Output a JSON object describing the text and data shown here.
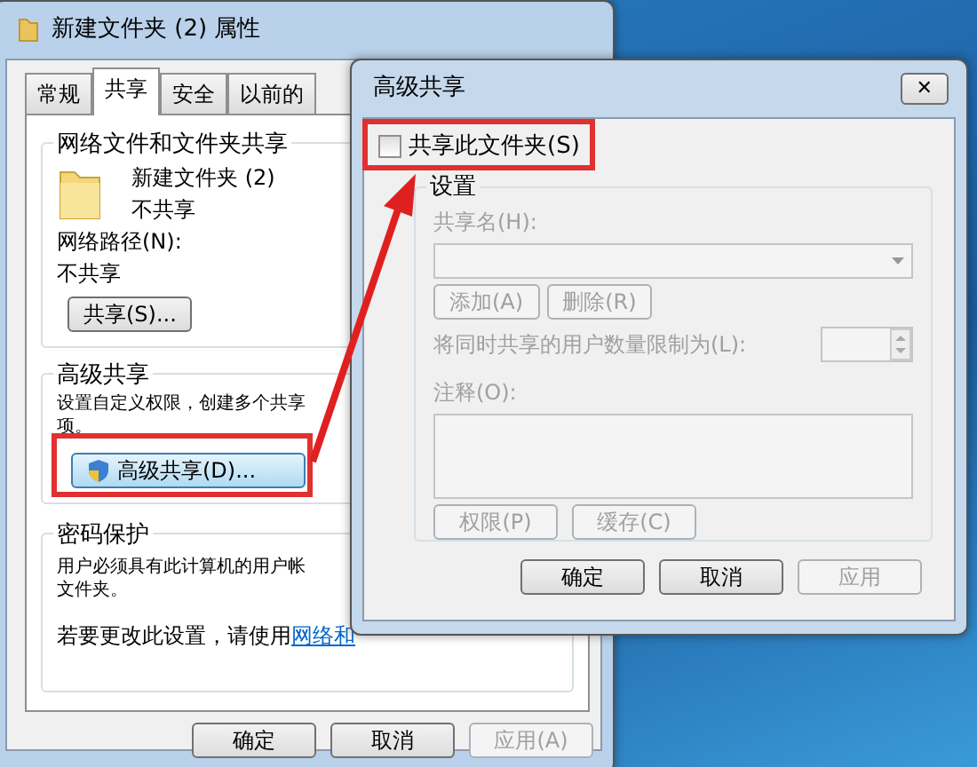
{
  "properties_window": {
    "title": "新建文件夹 (2) 属性",
    "tabs": [
      {
        "label": "常规",
        "selected": false
      },
      {
        "label": "共享",
        "selected": true
      },
      {
        "label": "安全",
        "selected": false
      },
      {
        "label": "以前的",
        "selected": false
      }
    ],
    "network_sharing": {
      "heading": "网络文件和文件夹共享",
      "folder_name": "新建文件夹 (2)",
      "folder_status": "不共享",
      "path_label": "网络路径(N):",
      "path_value": "不共享",
      "share_button": "共享(S)..."
    },
    "advanced_sharing": {
      "heading": "高级共享",
      "description": [
        "设置自定义权限，创建多个共享",
        "项。"
      ],
      "button": "高级共享(D)..."
    },
    "password_protection": {
      "heading": "密码保护",
      "description": [
        "用户必须具有此计算机的用户帐",
        "文件夹。"
      ],
      "change_text": "若要更改此设置，请使用",
      "link": "网络和"
    },
    "buttons": [
      {
        "label": "确定",
        "disabled": false
      },
      {
        "label": "取消",
        "disabled": false
      },
      {
        "label": "应用(A)",
        "disabled": true
      }
    ]
  },
  "advanced_dialog": {
    "title": "高级共享",
    "close": "✕",
    "share_checkbox": {
      "label": "共享此文件夹(S)",
      "checked": false
    },
    "settings": {
      "heading": "设置",
      "disabled": true,
      "share_name_label": "共享名(H):",
      "add_button": "添加(A)",
      "remove_button": "删除(R)",
      "limit_label": "将同时共享的用户数量限制为(L):",
      "comment_label": "注释(O):",
      "permissions_button": "权限(P)",
      "cache_button": "缓存(C)"
    },
    "buttons": [
      {
        "label": "确定",
        "disabled": false
      },
      {
        "label": "取消",
        "disabled": false
      },
      {
        "label": "应用",
        "disabled": true
      }
    ]
  }
}
